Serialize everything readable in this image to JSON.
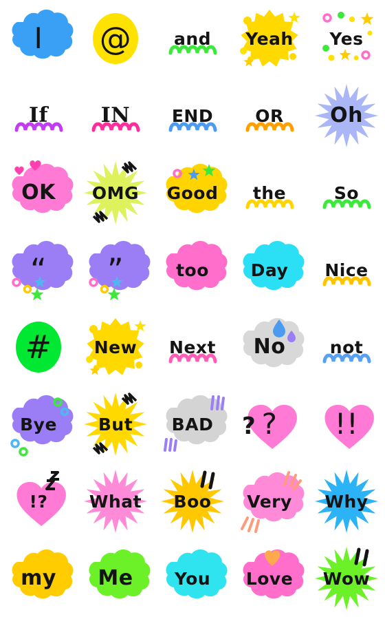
{
  "page": {
    "title": "Word Emoji Sticker Sheet",
    "background": "#ffffff",
    "columns": 5,
    "rows": 8,
    "cell_size": 112,
    "text_color": "#141414"
  },
  "palette": {
    "blue": "#3399f5",
    "yellow": "#ffe000",
    "gold": "#ffcc00",
    "green": "#00e832",
    "lime": "#6cf028",
    "yellow_green": "#ddf25c",
    "pink": "#ff6ecb",
    "hot_pink": "#ff7ad4",
    "light_pink": "#ff8ad8",
    "magenta": "#ff3fae",
    "purple": "#9b7ef5",
    "periwinkle": "#aab6f5",
    "cyan": "#2fe4ef",
    "sky": "#2bd5f5",
    "gray": "#d4d4d4",
    "orange": "#ffa94d",
    "salmon": "#ff9b7a",
    "azure": "#4d9bf0"
  },
  "stickers": [
    {
      "id": "i",
      "label": "I",
      "bg": "cloud",
      "bg_color": "#3aa0f5",
      "size": "s-sym",
      "deco": "none"
    },
    {
      "id": "at",
      "label": "@",
      "bg": "roundblob",
      "bg_color": "#ffe200",
      "size": "s-sym2",
      "deco": "none"
    },
    {
      "id": "and",
      "label": "and",
      "bg": "none",
      "bg_color": "",
      "size": "s-lg",
      "deco": "squiggle",
      "deco_color": "#3ce83c"
    },
    {
      "id": "yeah",
      "label": "Yeah",
      "bg": "splat",
      "bg_color": "#ffd900",
      "size": "s-lg",
      "deco": "spark-yellow"
    },
    {
      "id": "yes",
      "label": "Yes",
      "bg": "none",
      "bg_color": "",
      "size": "s-lg",
      "deco": "confetti-stars"
    },
    {
      "id": "if",
      "label": "If",
      "bg": "none",
      "bg_color": "",
      "size": "s-xl",
      "deco": "squiggle",
      "deco_color": "#c13df0",
      "serif": true
    },
    {
      "id": "in",
      "label": "IN",
      "bg": "none",
      "bg_color": "",
      "size": "s-xl",
      "deco": "squiggle",
      "deco_color": "#ff2e9a",
      "serif": true
    },
    {
      "id": "end",
      "label": "END",
      "bg": "none",
      "bg_color": "",
      "size": "s-lg",
      "deco": "squiggle",
      "deco_color": "#4d9bf0"
    },
    {
      "id": "or",
      "label": "OR",
      "bg": "none",
      "bg_color": "",
      "size": "s-lg",
      "deco": "squiggle",
      "deco_color": "#ffa000"
    },
    {
      "id": "oh",
      "label": "Oh",
      "bg": "starburst",
      "bg_color": "#aab6f5",
      "size": "s-xl",
      "deco": "none"
    },
    {
      "id": "ok",
      "label": "OK",
      "bg": "cloud",
      "bg_color": "#ff7ad4",
      "size": "s-xl",
      "deco": "hearts-pink"
    },
    {
      "id": "omg",
      "label": "OMG",
      "bg": "starburst",
      "bg_color": "#ddf25c",
      "size": "s-lg",
      "deco": "zigzag-black"
    },
    {
      "id": "good",
      "label": "Good",
      "bg": "cloud",
      "bg_color": "#ffd400",
      "size": "s-lg",
      "deco": "confetti-stars-top"
    },
    {
      "id": "the",
      "label": "the",
      "bg": "none",
      "bg_color": "",
      "size": "s-lg",
      "deco": "squiggle",
      "deco_color": "#ffd400"
    },
    {
      "id": "so",
      "label": "So",
      "bg": "none",
      "bg_color": "",
      "size": "s-lg",
      "deco": "squiggle",
      "deco_color": "#3ce83c"
    },
    {
      "id": "quote-open",
      "label": "“",
      "bg": "cloud",
      "bg_color": "#9b7ef5",
      "size": "s-sym2",
      "deco": "confetti-bottom"
    },
    {
      "id": "quote-close",
      "label": "”",
      "bg": "cloud",
      "bg_color": "#9b7ef5",
      "size": "s-sym2",
      "deco": "confetti-bottom"
    },
    {
      "id": "too",
      "label": "too",
      "bg": "cloud",
      "bg_color": "#ff6ecb",
      "size": "s-lg",
      "deco": "none"
    },
    {
      "id": "day",
      "label": "Day",
      "bg": "cloud",
      "bg_color": "#2bdff5",
      "size": "s-lg",
      "deco": "none"
    },
    {
      "id": "nice",
      "label": "Nice",
      "bg": "none",
      "bg_color": "",
      "size": "s-lg",
      "deco": "squiggle",
      "deco_color": "#ffc400"
    },
    {
      "id": "hash",
      "label": "#",
      "bg": "roundblob",
      "bg_color": "#00e832",
      "size": "s-sym2",
      "deco": "none"
    },
    {
      "id": "new",
      "label": "New",
      "bg": "splat",
      "bg_color": "#ffd900",
      "size": "s-lg",
      "deco": "spark-yellow"
    },
    {
      "id": "next",
      "label": "Next",
      "bg": "none",
      "bg_color": "",
      "size": "s-lg",
      "deco": "squiggle",
      "deco_color": "#ff5cb8"
    },
    {
      "id": "no",
      "label": "No",
      "bg": "cloud",
      "bg_color": "#d8d8d8",
      "size": "s-xl",
      "deco": "droplets"
    },
    {
      "id": "not",
      "label": "not",
      "bg": "none",
      "bg_color": "",
      "size": "s-lg",
      "deco": "squiggle",
      "deco_color": "#5aa0f0"
    },
    {
      "id": "bye",
      "label": "Bye",
      "bg": "cloud",
      "bg_color": "#9b7ef5",
      "size": "s-lg",
      "deco": "rings-green"
    },
    {
      "id": "but",
      "label": "But",
      "bg": "starburst",
      "bg_color": "#ffd900",
      "size": "s-lg",
      "deco": "zigzag-black"
    },
    {
      "id": "bad",
      "label": "BAD",
      "bg": "cloud",
      "bg_color": "#d4d4d4",
      "size": "s-lg",
      "deco": "lines-purple"
    },
    {
      "id": "question",
      "label": "?",
      "bg": "heart",
      "bg_color": "#ff7ad4",
      "size": "s-sym",
      "deco": "question-extra"
    },
    {
      "id": "exclaim",
      "label": "!!",
      "bg": "heart",
      "bg_color": "#ff7ad4",
      "size": "s-sym",
      "deco": "none"
    },
    {
      "id": "interrobang",
      "label": "!?",
      "bg": "heart",
      "bg_color": "#ff7ad4",
      "size": "s-lg",
      "deco": "zigzag-black-small"
    },
    {
      "id": "what",
      "label": "What",
      "bg": "starburst",
      "bg_color": "#ff8ad8",
      "size": "s-lg",
      "deco": "none"
    },
    {
      "id": "boo",
      "label": "Boo",
      "bg": "starburst",
      "bg_color": "#ffc800",
      "size": "s-lg",
      "deco": "bang-black"
    },
    {
      "id": "very",
      "label": "Very",
      "bg": "cloud",
      "bg_color": "#ff8ad8",
      "size": "s-lg",
      "deco": "lines-salmon"
    },
    {
      "id": "why",
      "label": "Why",
      "bg": "starburst",
      "bg_color": "#2bb3f5",
      "size": "s-lg",
      "deco": "none"
    },
    {
      "id": "my",
      "label": "my",
      "bg": "cloud",
      "bg_color": "#ffcc00",
      "size": "s-xl",
      "deco": "none"
    },
    {
      "id": "me",
      "label": "Me",
      "bg": "cloud",
      "bg_color": "#6cf028",
      "size": "s-xl",
      "deco": "none"
    },
    {
      "id": "you",
      "label": "You",
      "bg": "cloud",
      "bg_color": "#2fe4ef",
      "size": "s-lg",
      "deco": "none"
    },
    {
      "id": "love",
      "label": "Love",
      "bg": "cloud",
      "bg_color": "#ff6ecb",
      "size": "s-lg",
      "deco": "heart-orange"
    },
    {
      "id": "wow",
      "label": "Wow",
      "bg": "starburst",
      "bg_color": "#6cf028",
      "size": "s-lg",
      "deco": "bang-black"
    }
  ]
}
